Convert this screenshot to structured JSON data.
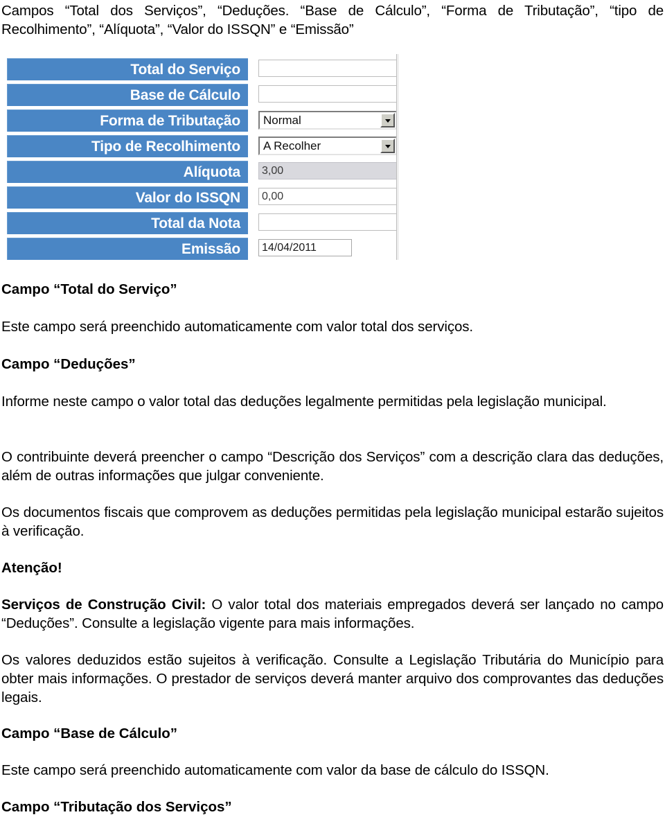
{
  "document": {
    "intro": "Campos “Total dos Serviços”, “Deduções. “Base de Cálculo”, “Forma de Tributação”, “tipo de Recolhimento”, “Alíquota”, “Valor do ISSQN” e “Emissão”"
  },
  "form": {
    "rows": [
      {
        "label": "Total do Serviço",
        "control": "text",
        "value": "",
        "style": "plain"
      },
      {
        "label": "Base de Cálculo",
        "control": "text",
        "value": "",
        "style": "plain"
      },
      {
        "label": "Forma de Tributação",
        "control": "select",
        "value": "Normal",
        "style": "combo"
      },
      {
        "label": "Tipo de Recolhimento",
        "control": "select",
        "value": "A Recolher",
        "style": "combo"
      },
      {
        "label": "Alíquota",
        "control": "text",
        "value": "3,00",
        "style": "readonly"
      },
      {
        "label": "Valor do ISSQN",
        "control": "text",
        "value": "0,00",
        "style": "plain"
      },
      {
        "label": "Total da Nota",
        "control": "text",
        "value": "",
        "style": "plain"
      },
      {
        "label": "Emissão",
        "control": "text",
        "value": "14/04/2011",
        "style": "narrow"
      }
    ],
    "colors": {
      "label_blue": "#4a86c5",
      "label_text": "#ffffff",
      "input_border": "#c8c8c8",
      "readonly_bg": "#d9d9de"
    }
  },
  "sections": {
    "h_total_servico": "Campo “Total do Serviço”",
    "p_total_servico": "Este campo será preenchido automaticamente com valor total dos serviços.",
    "h_deducoes": "Campo “Deduções”",
    "p_deducoes": "Informe neste campo o valor total das deduções legalmente permitidas pela legislação municipal.",
    "p_contribuinte": "O contribuinte deverá preencher o campo “Descrição dos Serviços” com a descrição clara das deduções, além de outras informações que julgar conveniente.",
    "p_documentos": "Os documentos fiscais que comprovem as deduções permitidas pela legislação municipal estarão sujeitos à verificação.",
    "h_atencao": "Atenção!",
    "p_construcao_bold": "Serviços de Construção Civil:",
    "p_construcao_rest": " O valor total dos materiais empregados deverá ser lançado no campo “Deduções”. Consulte a legislação vigente para mais informações.",
    "p_valores": "Os valores deduzidos estão sujeitos à verificação. Consulte a Legislação Tributária do Município para obter mais informações. O prestador de serviços deverá manter arquivo dos comprovantes das deduções legais.",
    "h_base_calculo": "Campo “Base de Cálculo”",
    "p_base_calculo": "Este campo será preenchido automaticamente com valor da base de cálculo do ISSQN.",
    "h_tributacao": "Campo “Tributação dos Serviços”"
  }
}
